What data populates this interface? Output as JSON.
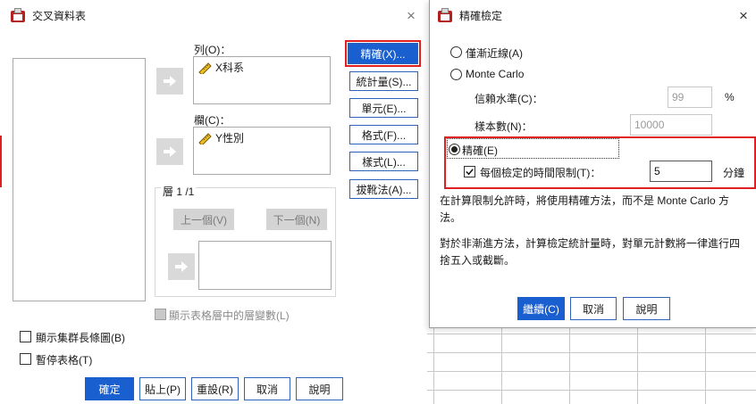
{
  "main_dialog": {
    "title": "交叉資料表",
    "close_glyph": "×",
    "rows_label": "列(O)：",
    "rows_value": "X科系",
    "cols_label": "欄(C)：",
    "cols_value": "Y性別",
    "layer_label": "層 1 /1",
    "prev_button": "上一個(V)",
    "next_button": "下一個(N)",
    "layer_vars_checkbox": "顯示表格層中的層變數(L)",
    "side_buttons": [
      "精確(X)...",
      "統計量(S)...",
      "單元(E)...",
      "格式(F)...",
      "樣式(L)...",
      "拔靴法(A)..."
    ],
    "clustered_bar_checkbox": "顯示集群長條圖(B)",
    "suppress_tables_checkbox": "暫停表格(T)",
    "bottom_buttons": [
      "確定",
      "貼上(P)",
      "重設(R)",
      "取消",
      "說明"
    ]
  },
  "exact_dialog": {
    "title": "精確檢定",
    "close_glyph": "×",
    "radio_asymptotic": "僅漸近線(A)",
    "radio_montecarlo": "Monte Carlo",
    "confidence_label": "信賴水準(C)：",
    "confidence_value": "99",
    "confidence_unit": "%",
    "samples_label": "樣本數(N)：",
    "samples_value": "10000",
    "radio_exact": "精確(E)",
    "time_limit_label": "每個檢定的時間限制(T)：",
    "time_limit_value": "5",
    "time_limit_unit": "分鐘",
    "info_text_1": "在計算限制允許時，將使用精確方法，而不是 Monte Carlo 方法。",
    "info_text_2": "對於非漸進方法，計算檢定統計量時，對單元計數將一律進行四捨五入或截斷。",
    "buttons": [
      "繼續(C)",
      "取消",
      "說明"
    ]
  }
}
